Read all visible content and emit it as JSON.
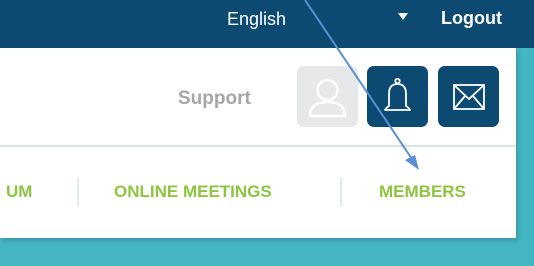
{
  "topbar": {
    "language": "English",
    "logout_label": "Logout"
  },
  "header": {
    "support_label": "Support"
  },
  "nav": {
    "items": [
      "UM",
      "ONLINE MEETINGS",
      "MEMBERS"
    ]
  },
  "colors": {
    "topbar_bg": "#0c4a72",
    "page_bg": "#44b5c3",
    "nav_text": "#8bc63f",
    "support_text": "#a6a6a6",
    "arrow": "#5b8fd3"
  },
  "icons": [
    "user-icon",
    "bell-icon",
    "mail-icon",
    "chevron-down-icon"
  ]
}
